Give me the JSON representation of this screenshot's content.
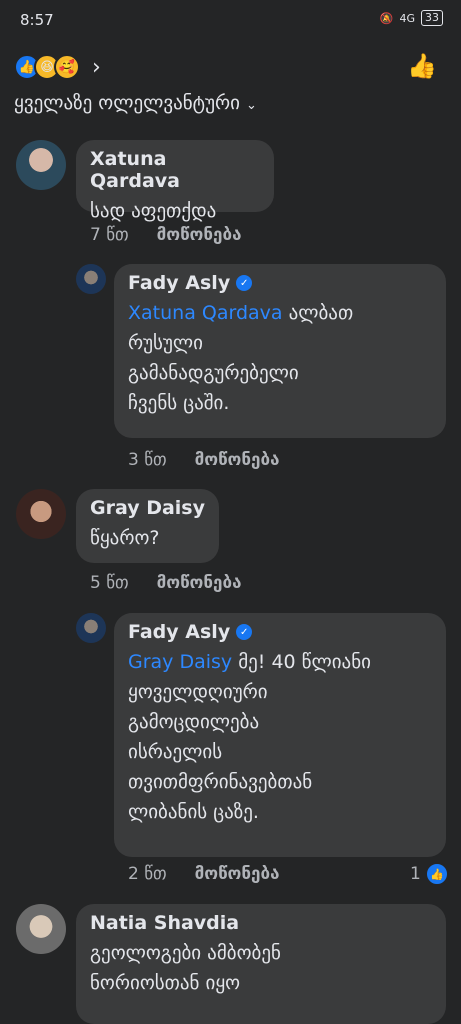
{
  "status": {
    "time": "8:57",
    "signal": "4G",
    "battery": "33"
  },
  "sort_label": "ყველაზე ოლელვანტური",
  "colors": {
    "bg": "#242526",
    "bubble": "#3a3b3c",
    "mention": "#2d88ff",
    "accent": "#1877f2"
  },
  "comments": [
    {
      "name": "Xatuna Qardava",
      "text": "სად აფეთქდა",
      "time": "7 წთ",
      "like": "მოწონება"
    },
    {
      "name": "Fady Asly",
      "mention": "Xatuna Qardava",
      "text_lines": [
        " ალბათ",
        "რუსული",
        "გამანადგურებელი",
        "ჩვენს ცაში."
      ],
      "time": "3 წთ",
      "like": "მოწონება"
    },
    {
      "name": "Gray Daisy",
      "text": "წყარო?",
      "time": "5 წთ",
      "like": "მოწონება"
    },
    {
      "name": "Fady Asly",
      "mention": "Gray Daisy",
      "text_lines": [
        " მე! 40 წლიანი",
        "ყოველდღიური",
        "გამოცდილება",
        "ისრაელის",
        "თვითმფრინავებთან",
        "ლიბანის ცაზე."
      ],
      "time": "2 წთ",
      "like": "მოწონება",
      "reaction_count": "1"
    },
    {
      "name": "Natia Shavdia",
      "text_lines": [
        "გეოლოგები ამბობენ",
        "ნორიოსთან იყო"
      ]
    }
  ]
}
